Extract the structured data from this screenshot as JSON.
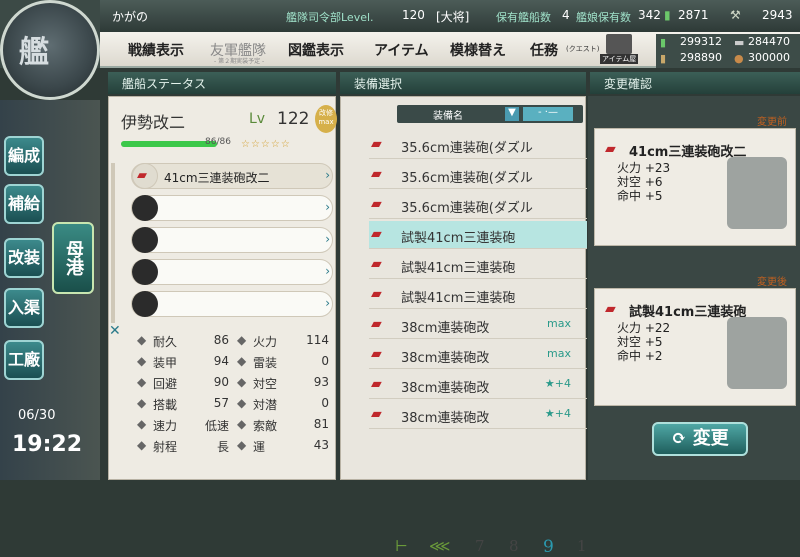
{
  "header": {
    "admiral_name": "かがの",
    "hq_label": "艦隊司令部Level.",
    "hq_level": "120",
    "rank": "[大将]",
    "ships_label": "保有艦船数",
    "ships_count": "4",
    "girls_label": "艦娘保有数",
    "girls_count": "342",
    "bucket_count": "2871",
    "devmat_count": "2943"
  },
  "menu": {
    "items": [
      "戦績表示",
      "友軍艦隊",
      "図鑑表示",
      "アイテム",
      "模様替え",
      "任務"
    ],
    "friend_sub": "- 第２期実装予定 -",
    "quest_sub": "(クエスト)",
    "item_shop": "アイテム屋"
  },
  "resources": {
    "fuel": "299312",
    "ammo": "298890",
    "steel": "284470",
    "bauxite": "300000"
  },
  "side_nav": [
    "編成",
    "補給",
    "改装",
    "入渠",
    "工廠"
  ],
  "side_nav_active": "母港",
  "datetime": {
    "date": "06/30",
    "time": "19:22"
  },
  "sections": {
    "ship_status": "艦船ステータス",
    "equip_select": "装備選択",
    "confirm": "変更確認"
  },
  "ship": {
    "name": "伊勢改二",
    "lv_label": "Lv",
    "level": "122",
    "badge": "改修 max",
    "hp_text": "86/86",
    "hp_fraction": 1.0,
    "stars": "☆☆☆☆☆",
    "slots": [
      "41cm三連装砲改二",
      "",
      "",
      "",
      ""
    ],
    "stats": [
      {
        "label": "耐久",
        "value": "86"
      },
      {
        "label": "火力",
        "value": "114"
      },
      {
        "label": "装甲",
        "value": "94"
      },
      {
        "label": "雷装",
        "value": "0"
      },
      {
        "label": "回避",
        "value": "90"
      },
      {
        "label": "対空",
        "value": "93"
      },
      {
        "label": "搭載",
        "value": "57"
      },
      {
        "label": "対潜",
        "value": "0"
      },
      {
        "label": "速力",
        "value": "低速"
      },
      {
        "label": "索敵",
        "value": "81"
      },
      {
        "label": "射程",
        "value": "長"
      },
      {
        "label": "運",
        "value": "43"
      }
    ]
  },
  "equip_list": {
    "sort_label": "装備名",
    "items": [
      {
        "name": "35.6cm連装砲(ダズル",
        "extra": ""
      },
      {
        "name": "35.6cm連装砲(ダズル",
        "extra": ""
      },
      {
        "name": "35.6cm連装砲(ダズル",
        "extra": ""
      },
      {
        "name": "試製41cm三連装砲",
        "extra": ""
      },
      {
        "name": "試製41cm三連装砲",
        "extra": ""
      },
      {
        "name": "試製41cm三連装砲",
        "extra": ""
      },
      {
        "name": "38cm連装砲改",
        "extra": "max"
      },
      {
        "name": "38cm連装砲改",
        "extra": "max"
      },
      {
        "name": "38cm連装砲改",
        "extra": "★+4"
      },
      {
        "name": "38cm連装砲改",
        "extra": "★+4"
      }
    ],
    "selected_index": 3,
    "pages": [
      "7",
      "8",
      "9",
      "1"
    ]
  },
  "confirm": {
    "before_label": "変更前",
    "after_label": "変更後",
    "before": {
      "name": "41cm三連装砲改二",
      "stats": [
        "火力 +23",
        "対空 +6",
        "命中 +5"
      ]
    },
    "after": {
      "name": "試製41cm三連装砲",
      "stats": [
        "火力 +22",
        "対空 +5",
        "命中 +2"
      ]
    },
    "change_button": "変更"
  }
}
